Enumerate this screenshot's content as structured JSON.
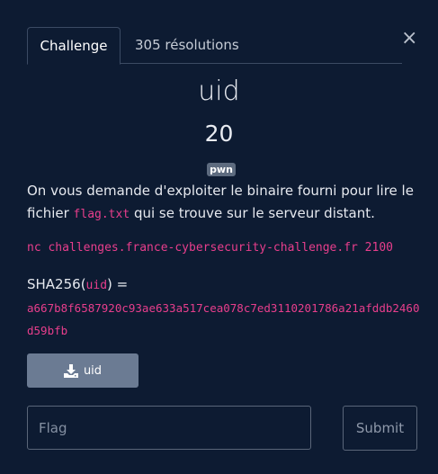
{
  "tabs": [
    {
      "label": "Challenge",
      "active": true
    },
    {
      "label": "305 résolutions",
      "active": false
    }
  ],
  "close_label": "×",
  "challenge": {
    "name": "uid",
    "points": "20",
    "category": "pwn",
    "description_before": "On vous demande d'exploiter le binaire fourni pour lire le fichier ",
    "description_file": "flag.txt",
    "description_after": " qui se trouve sur le serveur distant.",
    "connection": "nc challenges.france-cybersecurity-challenge.fr 2100",
    "sha_prefix": "SHA256(",
    "sha_file": "uid",
    "sha_suffix": ") =",
    "sha_value": "a667b8f6587920c93ae633a517cea078c7ed3110201786a21afddb2460d59bfb",
    "download_label": "uid"
  },
  "form": {
    "flag_placeholder": "Flag",
    "flag_value": "",
    "submit_label": "Submit"
  },
  "colors": {
    "background": "#0d1b32",
    "code_accent": "#e83e8c",
    "badge": "#5d6b7f",
    "download_button": "#6b7b93"
  }
}
